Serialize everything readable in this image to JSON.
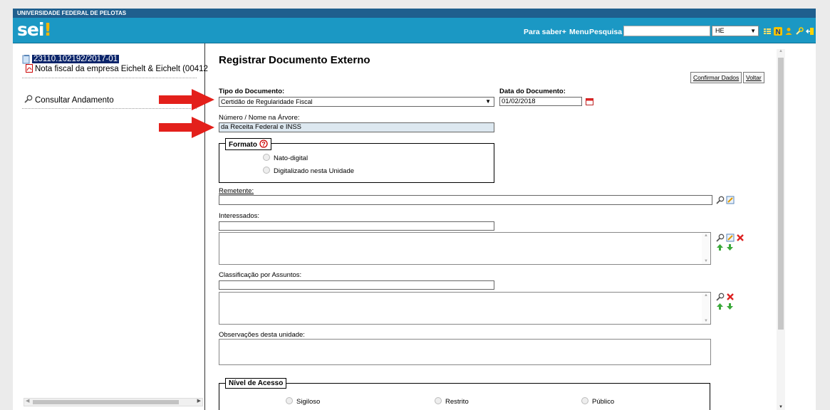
{
  "header": {
    "org_name": "UNIVERSIDADE FEDERAL DE PELOTAS",
    "logo_text": "sei",
    "logo_mark": "!",
    "links": {
      "para_saber": "Para saber+",
      "menu": "Menu",
      "pesquisa": "Pesquisa"
    },
    "search_value": "",
    "unit_select": "HE",
    "icons": [
      "list-icon",
      "notes-N-icon",
      "user-icon",
      "wrench-icon",
      "exit-icon"
    ]
  },
  "tree": {
    "process_number": "23110.102192/2017-01",
    "document": "Nota fiscal da empresa Eichelt & Eichelt (00412",
    "consultar": "Consultar Andamento"
  },
  "form": {
    "title": "Registrar Documento Externo",
    "buttons": {
      "confirm": "Confirmar Dados",
      "back": "Voltar"
    },
    "tipo_label": "Tipo do Documento:",
    "tipo_value": "Certidão de Regularidade Fiscal",
    "data_label": "Data do Documento:",
    "data_value": "01/02/2018",
    "numero_label": "Número / Nome na Árvore:",
    "numero_value": "da Receita Federal e INSS",
    "formato": {
      "legend": "Formato",
      "options": [
        "Nato-digital",
        "Digitalizado nesta Unidade"
      ]
    },
    "remetente_label": "Remetente:",
    "interessados_label": "Interessados:",
    "classificacao_label": "Classificação por Assuntos:",
    "observacoes_label": "Observações desta unidade:",
    "nivel": {
      "legend": "Nível de Acesso",
      "options": [
        "Sigiloso",
        "Restrito",
        "Público"
      ]
    }
  },
  "colors": {
    "navbar": "#1b98c4",
    "topbar": "#1f5f8e",
    "selection": "#0a246a",
    "arrow": "#e3201b"
  }
}
